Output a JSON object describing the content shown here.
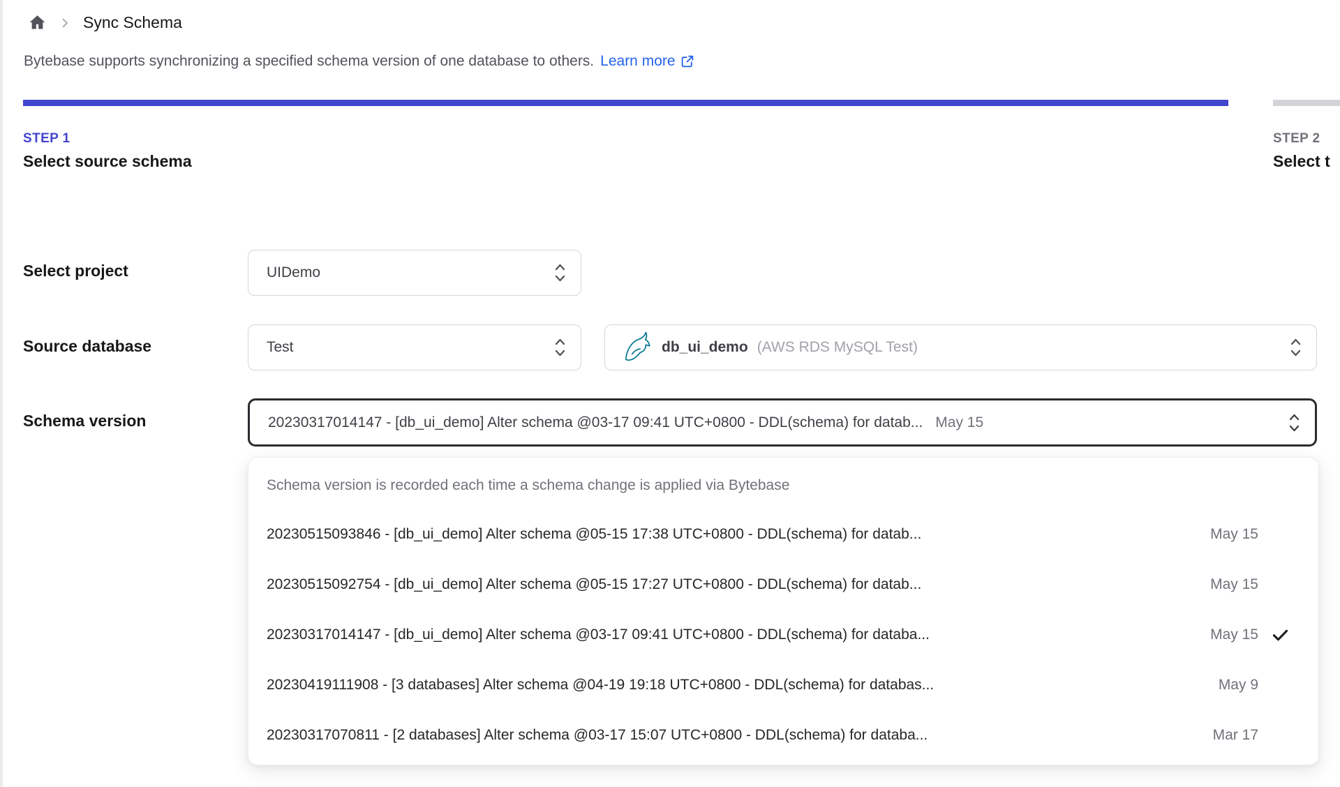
{
  "colors": {
    "accent": "#4245cd",
    "link": "#2563eb",
    "mysql": "#00758f",
    "inactive": "#d4d4d8"
  },
  "breadcrumb": {
    "title": "Sync Schema"
  },
  "intro": {
    "text": "Bytebase supports synchronizing a specified schema version of one database to others.",
    "link_label": "Learn more"
  },
  "steps": {
    "step1": {
      "label": "STEP 1",
      "title": "Select source schema"
    },
    "step2": {
      "label": "STEP 2",
      "title": "Select t"
    }
  },
  "form": {
    "project": {
      "label": "Select project",
      "value": "UIDemo"
    },
    "source_database": {
      "label": "Source database",
      "environment_value": "Test",
      "database_name": "db_ui_demo",
      "database_instance": "(AWS RDS MySQL Test)"
    },
    "schema_version": {
      "label": "Schema version",
      "value": "20230317014147 - [db_ui_demo] Alter schema @03-17 09:41 UTC+0800 - DDL(schema) for datab...",
      "date": "May 15"
    }
  },
  "version_dropdown": {
    "hint": "Schema version is recorded each time a schema change is applied via Bytebase",
    "options": [
      {
        "text": "20230515093846 - [db_ui_demo] Alter schema @05-15 17:38 UTC+0800 - DDL(schema) for datab...",
        "date": "May 15",
        "selected": false
      },
      {
        "text": "20230515092754 - [db_ui_demo] Alter schema @05-15 17:27 UTC+0800 - DDL(schema) for datab...",
        "date": "May 15",
        "selected": false
      },
      {
        "text": "20230317014147 - [db_ui_demo] Alter schema @03-17 09:41 UTC+0800 - DDL(schema) for databa...",
        "date": "May 15",
        "selected": true
      },
      {
        "text": "20230419111908 - [3 databases] Alter schema @04-19 19:18 UTC+0800 - DDL(schema) for databas...",
        "date": "May 9",
        "selected": false
      },
      {
        "text": "20230317070811 - [2 databases] Alter schema @03-17 15:07 UTC+0800 - DDL(schema) for databa...",
        "date": "Mar 17",
        "selected": false
      }
    ]
  }
}
